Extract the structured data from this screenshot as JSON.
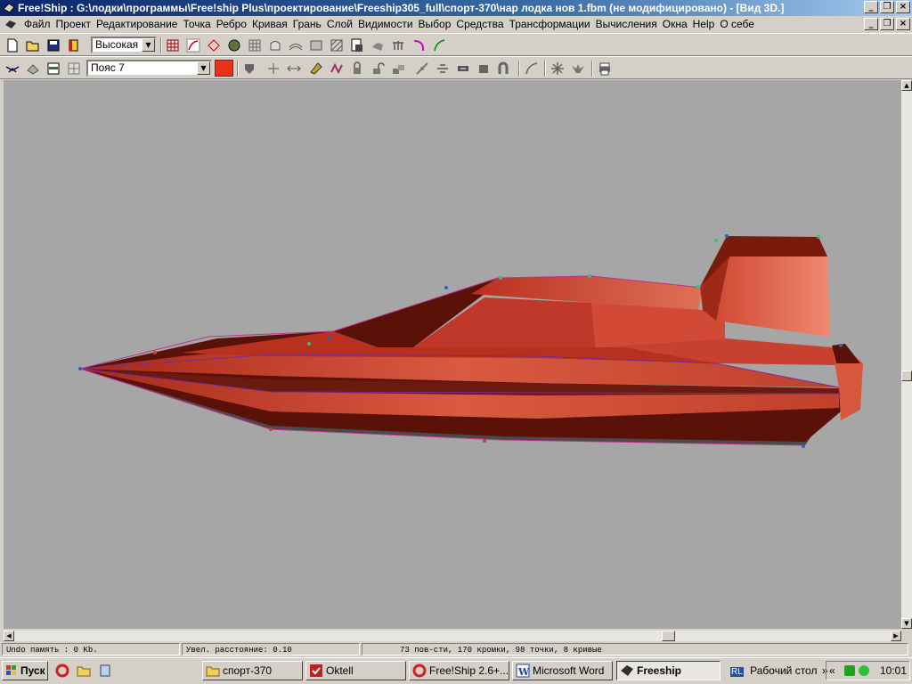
{
  "window": {
    "title": "Free!Ship : G:\\лодки\\программы\\Free!ship Plus\\проектирование\\Freeship305_full\\спорт-370\\нар лодка нов 1.fbm (не модифицировано) - [Вид 3D.]"
  },
  "menu": {
    "items": [
      "Файл",
      "Проект",
      "Редактирование",
      "Точка",
      "Ребро",
      "Кривая",
      "Грань",
      "Слой",
      "Видимости",
      "Выбор",
      "Средства",
      "Трансформации",
      "Вычисления",
      "Окна",
      "Help",
      "О себе"
    ]
  },
  "toolbar1": {
    "precision_value": "Высокая"
  },
  "toolbar2": {
    "layer_value": "Пояс 7",
    "layer_color": "#e8321e"
  },
  "statusbar": {
    "undo": "Undo память : 0 Kb.",
    "distance": "Увел. расстояние: 0.10",
    "counts": "73 пов-сти, 170 кромки, 98 точки, 8 кривые"
  },
  "taskbar": {
    "start_label": "Пуск",
    "tasks": [
      {
        "label": "спорт-370",
        "icon": "folder-icon"
      },
      {
        "label": "Oktell",
        "icon": "oktell-icon"
      },
      {
        "label": "Free!Ship 2.6+...",
        "icon": "opera-icon"
      },
      {
        "label": "Microsoft Word",
        "icon": "word-icon"
      },
      {
        "label": "Freeship",
        "icon": "freeship-icon"
      }
    ],
    "lang": "RL",
    "desktop_label": "Рабочий стол",
    "chevron": "»",
    "tray_chevron": "«",
    "clock": "10:01"
  },
  "colors": {
    "viewport_bg": "#a6a6a6",
    "hull_red": "#c83c2c",
    "hull_dark": "#5a1208",
    "title_blue": "#0a246a"
  }
}
